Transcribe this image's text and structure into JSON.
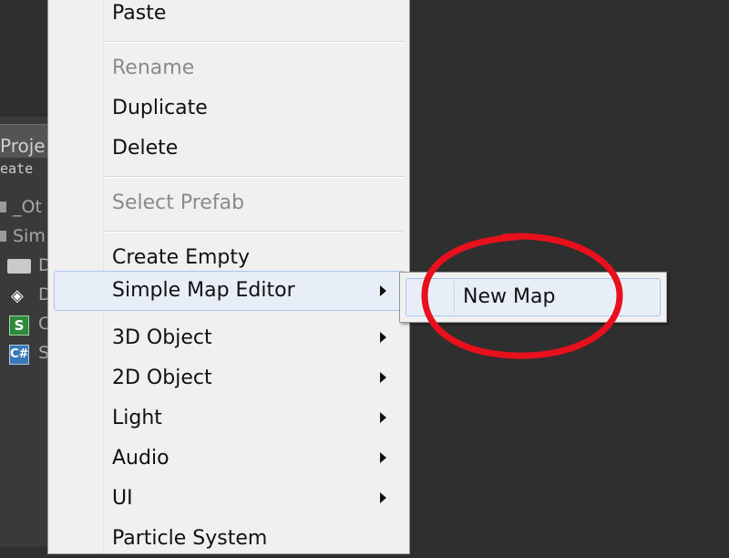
{
  "background_panel": {
    "tab_label": "Proje",
    "create_label": "eate",
    "items": [
      {
        "text": "_Ot"
      },
      {
        "text": "Sim"
      },
      {
        "text": "D"
      },
      {
        "text": "D"
      },
      {
        "text": "C"
      },
      {
        "text": "S"
      }
    ],
    "icons": {
      "s_icon_glyph": "S",
      "cs_icon_glyph": "C#"
    }
  },
  "context_menu": {
    "items": [
      {
        "label": "Paste",
        "disabled": false,
        "has_submenu": false
      },
      {
        "label": "Rename",
        "disabled": true,
        "has_submenu": false
      },
      {
        "label": "Duplicate",
        "disabled": false,
        "has_submenu": false
      },
      {
        "label": "Delete",
        "disabled": false,
        "has_submenu": false
      },
      {
        "label": "Select Prefab",
        "disabled": true,
        "has_submenu": false
      },
      {
        "label": "Create Empty",
        "disabled": false,
        "has_submenu": false
      },
      {
        "label": "Simple Map Editor",
        "disabled": false,
        "has_submenu": true,
        "highlighted": true
      },
      {
        "label": "3D Object",
        "disabled": false,
        "has_submenu": true
      },
      {
        "label": "2D Object",
        "disabled": false,
        "has_submenu": true
      },
      {
        "label": "Light",
        "disabled": false,
        "has_submenu": true
      },
      {
        "label": "Audio",
        "disabled": false,
        "has_submenu": true
      },
      {
        "label": "UI",
        "disabled": false,
        "has_submenu": true
      },
      {
        "label": "Particle System",
        "disabled": false,
        "has_submenu": false
      }
    ]
  },
  "submenu": {
    "items": [
      {
        "label": "New Map",
        "highlighted": true
      }
    ]
  },
  "annotation": {
    "shape": "ellipse",
    "color": "#e8101c"
  },
  "colors": {
    "menu_background": "#f0f0f0",
    "highlight_fill": "#e8eef8",
    "highlight_border": "#aac6ee",
    "disabled_text": "#8a8a8a",
    "editor_background": "#2f2f2f"
  }
}
